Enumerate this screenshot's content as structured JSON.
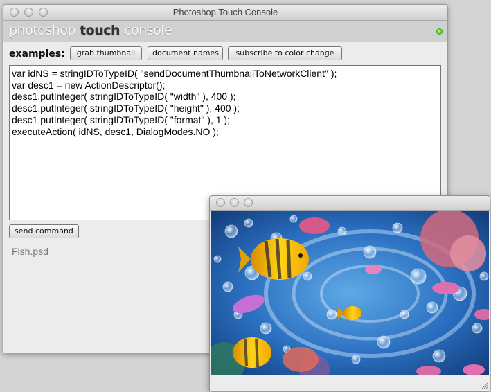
{
  "console": {
    "window_title": "Photoshop Touch Console",
    "brand": {
      "prefix": "photoshop",
      "middle": "touch",
      "suffix": "console"
    },
    "status_color": "#3aaa1a",
    "examples_label": "examples:",
    "example_buttons": [
      "grab thumbnail",
      "document names",
      "subscribe to color change"
    ],
    "code_lines": [
      "var idNS = stringIDToTypeID( \"sendDocumentThumbnailToNetworkClient\" );",
      "var desc1 = new ActionDescriptor();",
      "desc1.putInteger( stringIDToTypeID( \"width\" ), 400 );",
      "desc1.putInteger( stringIDToTypeID( \"height\" ), 400 );",
      "desc1.putInteger( stringIDToTypeID( \"format\" ), 1 );",
      "executeAction( idNS, desc1, DialogModes.NO );"
    ],
    "send_label": "send command",
    "filename": "Fish.psd"
  },
  "image_window": {
    "image_subject": "aquarium-fish-thumbnail"
  }
}
